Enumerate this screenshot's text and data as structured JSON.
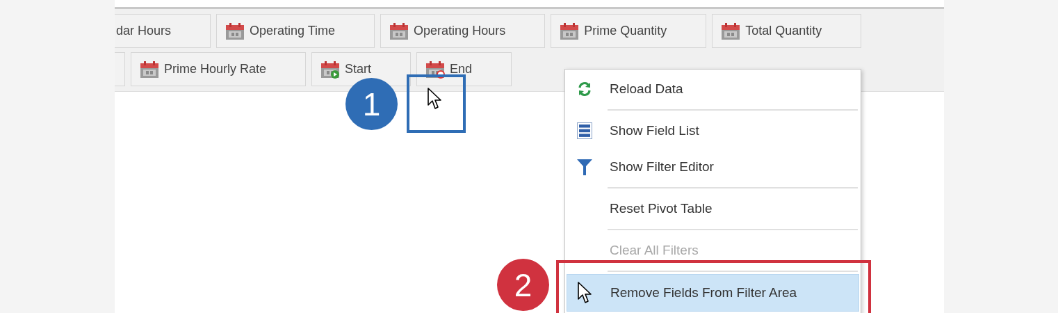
{
  "filter_area": {
    "top_row": [
      {
        "kind": "cut",
        "label": "dar Hours"
      },
      {
        "kind": "plain",
        "label": "Operating Time"
      },
      {
        "kind": "plain",
        "label": "Operating Hours"
      },
      {
        "kind": "plain",
        "label": "Prime Quantity"
      },
      {
        "kind": "plain",
        "label": "Total Quantity"
      }
    ],
    "bottom_row": [
      {
        "kind": "cut"
      },
      {
        "kind": "plain",
        "label": "Prime Hourly Rate"
      },
      {
        "kind": "start",
        "label": "Start"
      },
      {
        "kind": "end",
        "label": "End"
      }
    ]
  },
  "context_menu": {
    "groups": [
      [
        {
          "kind": "reload",
          "label": "Reload Data",
          "selected": false,
          "disabled": false
        }
      ],
      [
        {
          "kind": "list",
          "label": "Show Field List",
          "selected": false,
          "disabled": false
        },
        {
          "kind": "filter",
          "label": "Show Filter Editor",
          "selected": false,
          "disabled": false
        }
      ],
      [
        {
          "kind": "plain",
          "label": "Reset Pivot Table",
          "selected": false,
          "disabled": false
        }
      ],
      [
        {
          "kind": "plain",
          "label": "Clear All Filters",
          "selected": false,
          "disabled": true
        }
      ],
      [
        {
          "kind": "plain",
          "label": "Remove Fields From Filter Area",
          "selected": true,
          "disabled": false
        }
      ]
    ]
  },
  "callouts": [
    {
      "number": "1",
      "color": "#2f6db5"
    },
    {
      "number": "2",
      "color": "#d0323f"
    }
  ]
}
